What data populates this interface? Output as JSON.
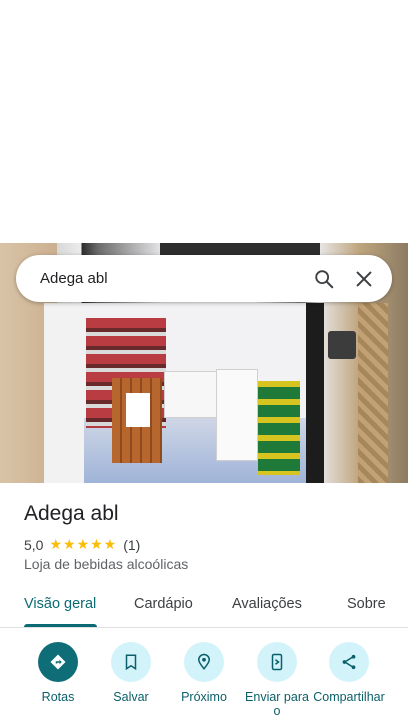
{
  "search": {
    "query": "Adega abl"
  },
  "place": {
    "name": "Adega abl",
    "rating": "5,0",
    "stars": "★★★★★",
    "review_count": "(1)",
    "category": "Loja de bebidas alcoólicas"
  },
  "tabs": [
    {
      "label": "Visão geral",
      "active": true
    },
    {
      "label": "Cardápio"
    },
    {
      "label": "Avaliações"
    },
    {
      "label": "Sobre"
    }
  ],
  "actions": [
    {
      "label": "Rotas",
      "icon": "directions-icon"
    },
    {
      "label": "Salvar",
      "icon": "bookmark-icon"
    },
    {
      "label": "Próximo",
      "icon": "nearby-icon"
    },
    {
      "label": "Enviar para o",
      "icon": "send-to-phone-icon"
    },
    {
      "label": "Compartilhar",
      "icon": "share-icon"
    }
  ],
  "colors": {
    "accent": "#0b6b73",
    "star": "#fbbc04",
    "action_bg": "#d3f3fb"
  }
}
